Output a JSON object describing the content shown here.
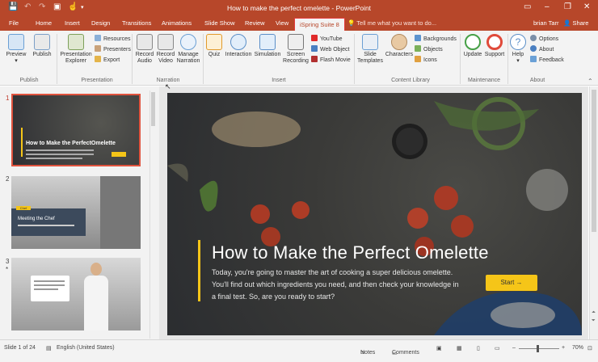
{
  "window": {
    "title": "How to make the perfect omelette - PowerPoint"
  },
  "tabs": [
    "File",
    "Home",
    "Insert",
    "Design",
    "Transitions",
    "Animations",
    "Slide Show",
    "Review",
    "View",
    "iSpring Suite 8"
  ],
  "tellme": "Tell me what you want to do...",
  "user": "brian Tarr",
  "share": "Share",
  "ribbon": {
    "preview": "Preview",
    "publish": "Publish",
    "presentation_explorer": "Presentation Explorer",
    "resources": "Resources",
    "presenters": "Presenters",
    "export": "Export",
    "record_audio": "Record Audio",
    "record_video": "Record Video",
    "manage_narration": "Manage Narration",
    "quiz": "Quiz",
    "interaction": "Interaction",
    "simulation": "Simulation",
    "screen_recording": "Screen Recording",
    "youtube": "YouTube",
    "web_object": "Web Object",
    "flash_movie": "Flash Movie",
    "slide_templates": "Slide Templates",
    "characters": "Characters",
    "backgrounds": "Backgrounds",
    "objects": "Objects",
    "icons": "Icons",
    "update": "Update",
    "support": "Support",
    "help": "Help",
    "options": "Options",
    "about": "About",
    "feedback": "Feedback",
    "groups": {
      "publish": "Publish",
      "presentation": "Presentation",
      "narration": "Narration",
      "insert": "Insert",
      "content_library": "Content Library",
      "maintenance": "Maintenance",
      "about": "About"
    }
  },
  "thumbnails": [
    {
      "num": "1",
      "title": "How to Make the PerfectOmelette"
    },
    {
      "num": "2",
      "title": "Meeting the Chef",
      "badge": "Chef"
    },
    {
      "num": "3",
      "star": "*"
    }
  ],
  "slide": {
    "title": "How to Make the Perfect Omelette",
    "body": "Today, you're going to master the art of cooking a super delicious omelette. You'll find out which ingredients you need, and then check your knowledge in a final test. So, are you ready to start?",
    "button": "Start →"
  },
  "status": {
    "slide": "Slide 1 of 24",
    "language": "English (United States)",
    "notes": "Notes",
    "comments": "Comments",
    "zoom": "70%"
  },
  "colors": {
    "accent": "#b7472a",
    "yellow": "#f5c518",
    "ispring_tab_border": "#e23b3b"
  }
}
